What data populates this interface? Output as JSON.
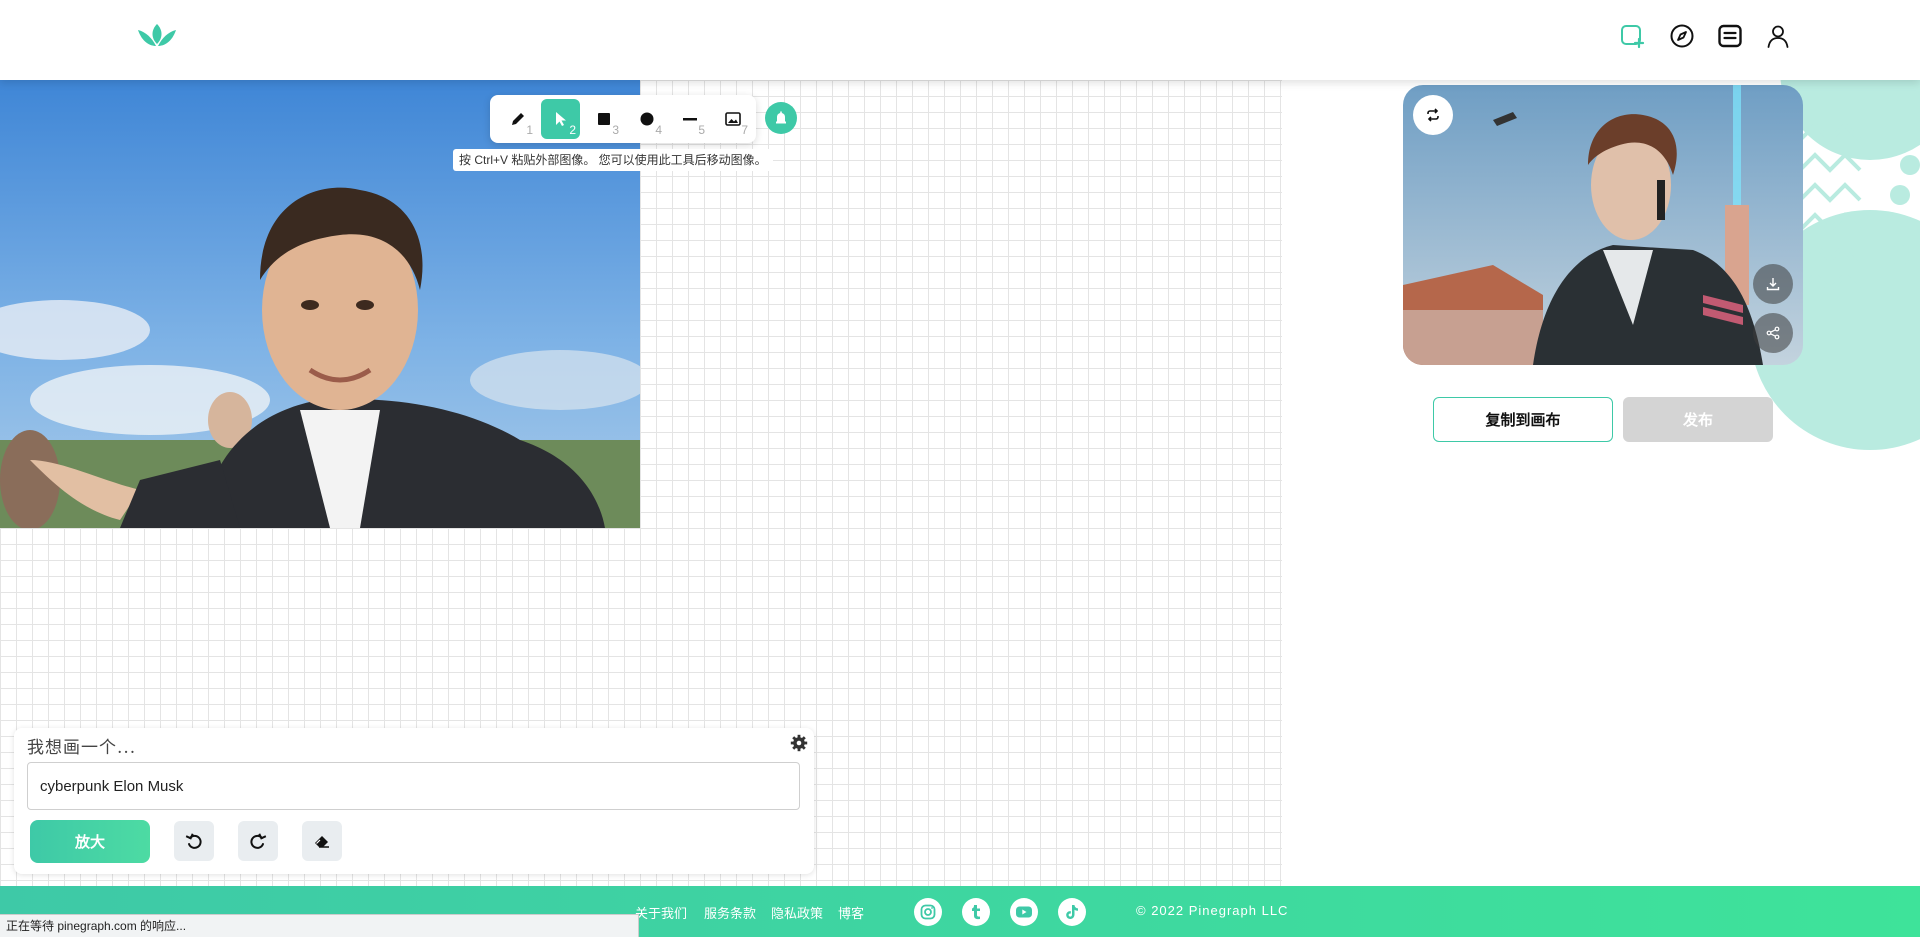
{
  "header": {
    "logo_icon": "leaf-logo",
    "icons": [
      "add-canvas-icon",
      "compass-icon",
      "document-icon",
      "user-icon"
    ]
  },
  "toolbar": {
    "tools": [
      {
        "icon": "pencil-icon",
        "num": "1"
      },
      {
        "icon": "pointer-icon",
        "num": "2",
        "active": true
      },
      {
        "icon": "square-icon",
        "num": "3"
      },
      {
        "icon": "circle-icon",
        "num": "4"
      },
      {
        "icon": "line-icon",
        "num": "5"
      },
      {
        "icon": "image-icon",
        "num": "7"
      }
    ],
    "extra_icon": "bell-icon",
    "hint": "按 Ctrl+V 粘贴外部图像。 您可以使用此工具后移动图像。"
  },
  "prompt": {
    "label": "我想画一个...",
    "value": "cyberpunk Elon Musk",
    "upscale_label": "放大"
  },
  "result": {
    "copy_label": "复制到画布",
    "publish_label": "发布"
  },
  "footer": {
    "links": [
      "关于我们",
      "服务条款",
      "隐私政策",
      "博客"
    ],
    "social": [
      "instagram-icon",
      "tumblr-icon",
      "youtube-icon",
      "tiktok-icon"
    ],
    "copyright": "© 2022 Pinegraph LLC"
  },
  "status_bar": {
    "text": "正在等待 pinegraph.com 的响应..."
  },
  "colors": {
    "accent": "#3ec9a7",
    "accent_light": "#b9ebe0",
    "disabled": "#d4d4d4"
  }
}
